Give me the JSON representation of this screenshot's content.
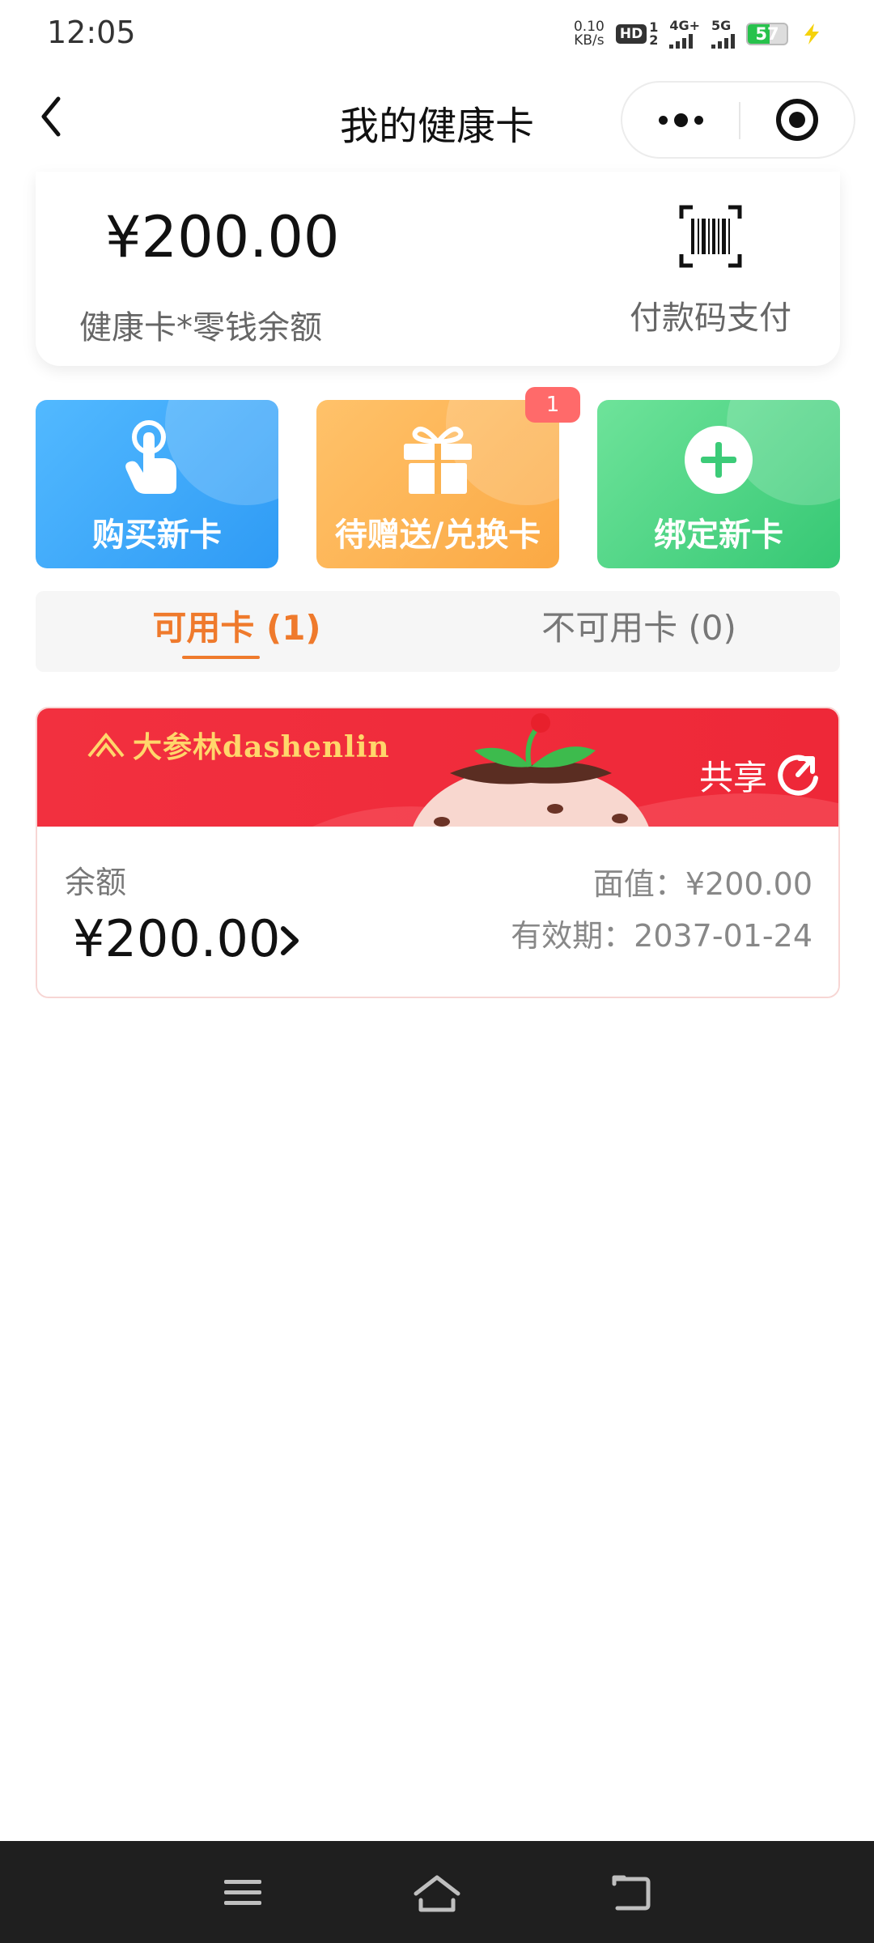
{
  "status_bar": {
    "time": "12:05",
    "net_speed_value": "0.10",
    "net_speed_unit": "KB/s",
    "hd_label": "HD",
    "hd_sim_top": "1",
    "hd_sim_bottom": "2",
    "network_1": "4G+",
    "network_2": "5G",
    "battery_level": "57",
    "battery_fraction": 0.57
  },
  "title_bar": {
    "title": "我的健康卡",
    "back_icon": "chevron-left-icon",
    "more_icon": "more-dots-icon",
    "close_icon": "target-circle-icon"
  },
  "balance_card": {
    "amount": "¥200.00",
    "label": "健康卡*零钱余额",
    "pay_code_label": "付款码支付",
    "pay_code_icon": "barcode-scan-icon"
  },
  "actions": [
    {
      "label": "购买新卡",
      "icon": "tap-hand-icon"
    },
    {
      "label": "待赠送/兑换卡",
      "icon": "gift-icon",
      "badge": "1"
    },
    {
      "label": "绑定新卡",
      "icon": "plus-circle-icon"
    }
  ],
  "tabs": {
    "available": "可用卡 (1)",
    "unavailable": "不可用卡 (0)"
  },
  "card": {
    "brand": "大参林dashenlin",
    "share_label": "共享",
    "balance_label": "余额",
    "balance_value": "¥200.00",
    "face_value": "面值：¥200.00",
    "expiry": "有效期：2037-01-24"
  },
  "colors": {
    "accent_orange": "#ef7a2c",
    "card_red": "#f2303f",
    "buy_blue": "#2f9bf5",
    "gift_orange": "#fba944",
    "bind_green": "#36c874",
    "badge_red": "#ff6a6a"
  },
  "nav_bar": {
    "menu_icon": "menu-lines-icon",
    "home_icon": "home-icon",
    "back_icon": "back-arrow-icon"
  }
}
